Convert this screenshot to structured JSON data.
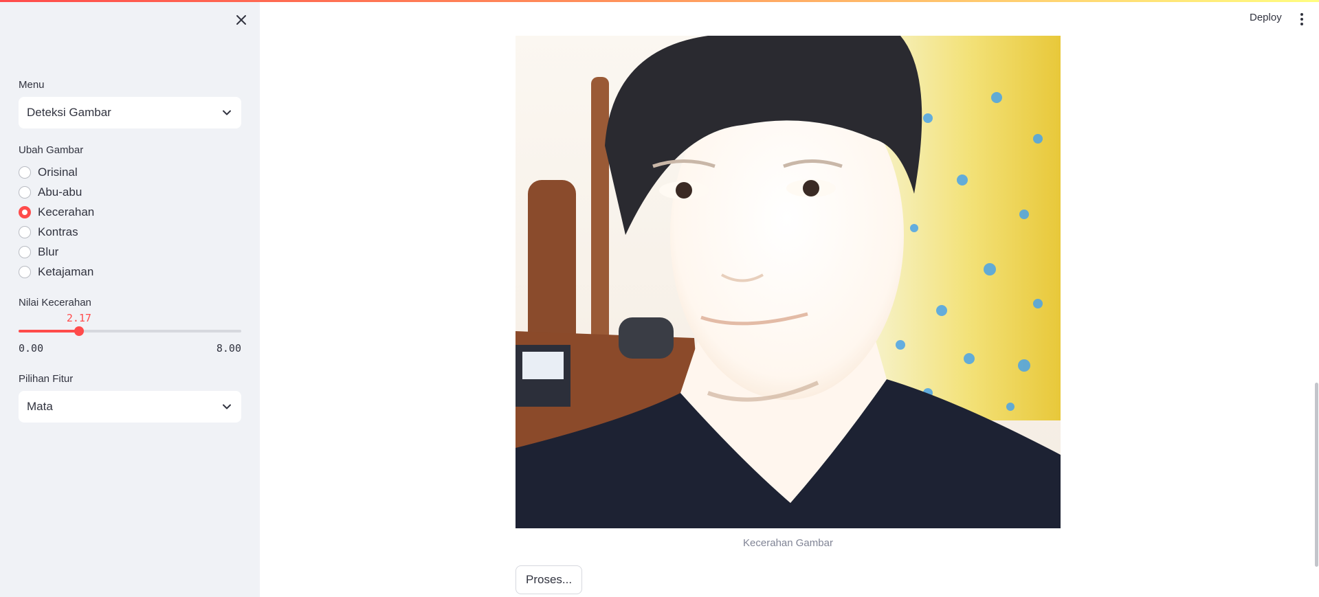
{
  "sidebar": {
    "menu_label": "Menu",
    "menu_value": "Deteksi Gambar",
    "ubah_label": "Ubah Gambar",
    "ubah_options": [
      "Orisinal",
      "Abu-abu",
      "Kecerahan",
      "Kontras",
      "Blur",
      "Ketajaman"
    ],
    "ubah_selected": "Kecerahan",
    "slider_label": "Nilai Kecerahan",
    "slider_value": "2.17",
    "slider_min": "0.00",
    "slider_max": "8.00",
    "fitur_label": "Pilihan Fitur",
    "fitur_value": "Mata"
  },
  "header": {
    "deploy_label": "Deploy"
  },
  "main": {
    "image_caption": "Kecerahan Gambar",
    "proses_label": "Proses..."
  },
  "colors": {
    "accent": "#ff4b4b",
    "sidebar_bg": "#f0f2f6",
    "text": "#31333f",
    "muted": "#808495"
  }
}
